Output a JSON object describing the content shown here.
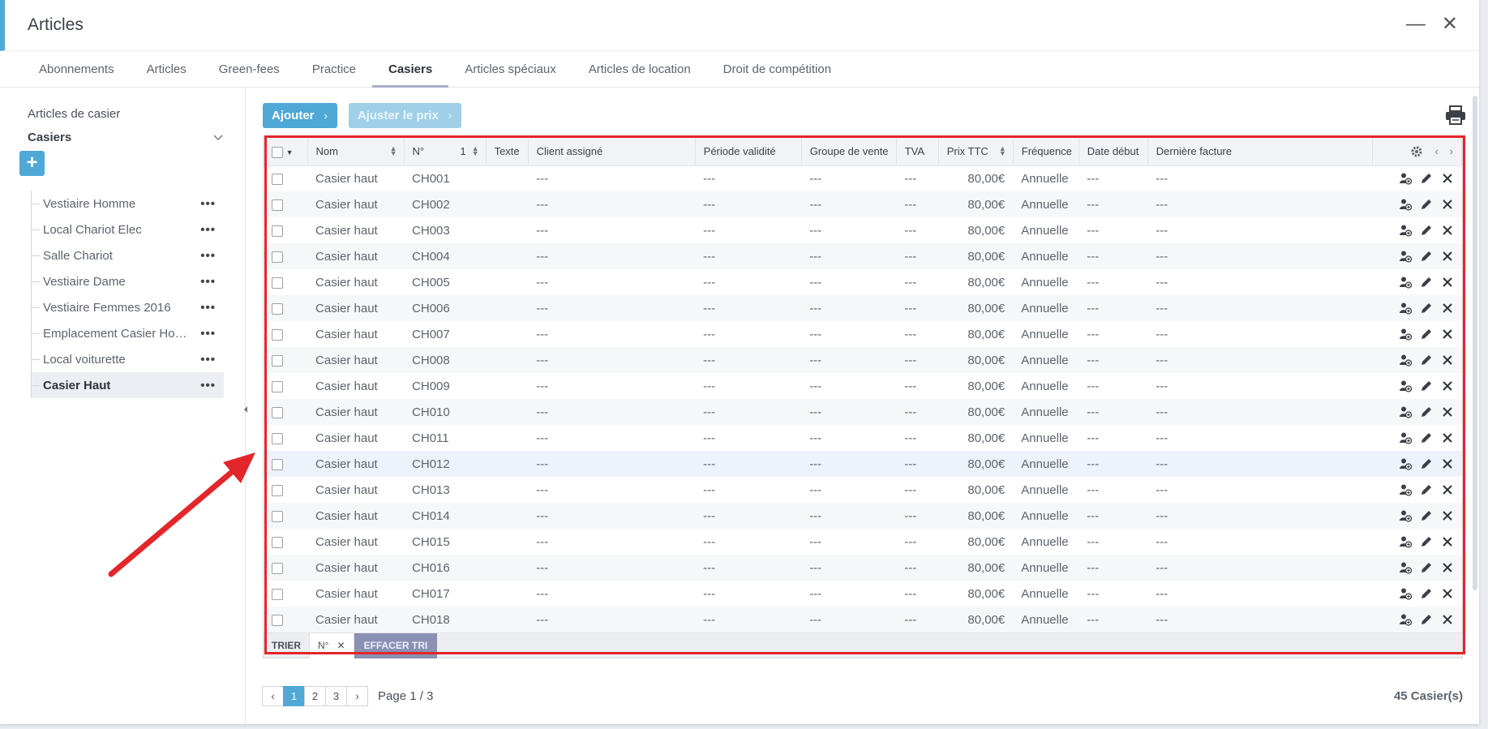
{
  "window": {
    "title": "Articles",
    "minimize": "—",
    "close": "✕"
  },
  "tabs": [
    "Abonnements",
    "Articles",
    "Green-fees",
    "Practice",
    "Casiers",
    "Articles spéciaux",
    "Articles de location",
    "Droit de compétition"
  ],
  "sidebar": {
    "title": "Articles de casier",
    "group": "Casiers",
    "add_label": "+",
    "items": [
      {
        "label": "Vestiaire Homme"
      },
      {
        "label": "Local Chariot Elec"
      },
      {
        "label": "Salle Chariot"
      },
      {
        "label": "Vestiaire Dame"
      },
      {
        "label": "Vestiaire Femmes 2016"
      },
      {
        "label": "Emplacement Casier Hom..."
      },
      {
        "label": "Local voiturette"
      },
      {
        "label": "Casier Haut"
      }
    ],
    "selected_index": 7,
    "dots": "•••"
  },
  "toolbar": {
    "add_label": "Ajouter",
    "adjust_label": "Ajuster le prix"
  },
  "table": {
    "columns": [
      "Nom",
      "N°",
      "Texte",
      "Client assigné",
      "Période validité",
      "Groupe de vente",
      "TVA",
      "Prix TTC",
      "Fréquence",
      "Date début",
      "Dernière facture"
    ],
    "sort_index": "1",
    "rows": [
      {
        "nom": "Casier haut",
        "num": "CH001",
        "texte": "",
        "client": "---",
        "periode": "---",
        "groupe": "---",
        "tva": "---",
        "prix": "80,00€",
        "freq": "Annuelle",
        "debut": "---",
        "facture": "---"
      },
      {
        "nom": "Casier haut",
        "num": "CH002",
        "texte": "",
        "client": "---",
        "periode": "---",
        "groupe": "---",
        "tva": "---",
        "prix": "80,00€",
        "freq": "Annuelle",
        "debut": "---",
        "facture": "---"
      },
      {
        "nom": "Casier haut",
        "num": "CH003",
        "texte": "",
        "client": "---",
        "periode": "---",
        "groupe": "---",
        "tva": "---",
        "prix": "80,00€",
        "freq": "Annuelle",
        "debut": "---",
        "facture": "---"
      },
      {
        "nom": "Casier haut",
        "num": "CH004",
        "texte": "",
        "client": "---",
        "periode": "---",
        "groupe": "---",
        "tva": "---",
        "prix": "80,00€",
        "freq": "Annuelle",
        "debut": "---",
        "facture": "---"
      },
      {
        "nom": "Casier haut",
        "num": "CH005",
        "texte": "",
        "client": "---",
        "periode": "---",
        "groupe": "---",
        "tva": "---",
        "prix": "80,00€",
        "freq": "Annuelle",
        "debut": "---",
        "facture": "---"
      },
      {
        "nom": "Casier haut",
        "num": "CH006",
        "texte": "",
        "client": "---",
        "periode": "---",
        "groupe": "---",
        "tva": "---",
        "prix": "80,00€",
        "freq": "Annuelle",
        "debut": "---",
        "facture": "---"
      },
      {
        "nom": "Casier haut",
        "num": "CH007",
        "texte": "",
        "client": "---",
        "periode": "---",
        "groupe": "---",
        "tva": "---",
        "prix": "80,00€",
        "freq": "Annuelle",
        "debut": "---",
        "facture": "---"
      },
      {
        "nom": "Casier haut",
        "num": "CH008",
        "texte": "",
        "client": "---",
        "periode": "---",
        "groupe": "---",
        "tva": "---",
        "prix": "80,00€",
        "freq": "Annuelle",
        "debut": "---",
        "facture": "---"
      },
      {
        "nom": "Casier haut",
        "num": "CH009",
        "texte": "",
        "client": "---",
        "periode": "---",
        "groupe": "---",
        "tva": "---",
        "prix": "80,00€",
        "freq": "Annuelle",
        "debut": "---",
        "facture": "---"
      },
      {
        "nom": "Casier haut",
        "num": "CH010",
        "texte": "",
        "client": "---",
        "periode": "---",
        "groupe": "---",
        "tva": "---",
        "prix": "80,00€",
        "freq": "Annuelle",
        "debut": "---",
        "facture": "---"
      },
      {
        "nom": "Casier haut",
        "num": "CH011",
        "texte": "",
        "client": "---",
        "periode": "---",
        "groupe": "---",
        "tva": "---",
        "prix": "80,00€",
        "freq": "Annuelle",
        "debut": "---",
        "facture": "---"
      },
      {
        "nom": "Casier haut",
        "num": "CH012",
        "texte": "",
        "client": "---",
        "periode": "---",
        "groupe": "---",
        "tva": "---",
        "prix": "80,00€",
        "freq": "Annuelle",
        "debut": "---",
        "facture": "---"
      },
      {
        "nom": "Casier haut",
        "num": "CH013",
        "texte": "",
        "client": "---",
        "periode": "---",
        "groupe": "---",
        "tva": "---",
        "prix": "80,00€",
        "freq": "Annuelle",
        "debut": "---",
        "facture": "---"
      },
      {
        "nom": "Casier haut",
        "num": "CH014",
        "texte": "",
        "client": "---",
        "periode": "---",
        "groupe": "---",
        "tva": "---",
        "prix": "80,00€",
        "freq": "Annuelle",
        "debut": "---",
        "facture": "---"
      },
      {
        "nom": "Casier haut",
        "num": "CH015",
        "texte": "",
        "client": "---",
        "periode": "---",
        "groupe": "---",
        "tva": "---",
        "prix": "80,00€",
        "freq": "Annuelle",
        "debut": "---",
        "facture": "---"
      },
      {
        "nom": "Casier haut",
        "num": "CH016",
        "texte": "",
        "client": "---",
        "periode": "---",
        "groupe": "---",
        "tva": "---",
        "prix": "80,00€",
        "freq": "Annuelle",
        "debut": "---",
        "facture": "---"
      },
      {
        "nom": "Casier haut",
        "num": "CH017",
        "texte": "",
        "client": "---",
        "periode": "---",
        "groupe": "---",
        "tva": "---",
        "prix": "80,00€",
        "freq": "Annuelle",
        "debut": "---",
        "facture": "---"
      },
      {
        "nom": "Casier haut",
        "num": "CH018",
        "texte": "",
        "client": "---",
        "periode": "---",
        "groupe": "---",
        "tva": "---",
        "prix": "80,00€",
        "freq": "Annuelle",
        "debut": "---",
        "facture": "---"
      }
    ],
    "hover_row": 11
  },
  "sort_bar": {
    "label": "TRIER",
    "chip": "N°",
    "clear": "EFFACER TRI"
  },
  "pagination": {
    "prev": "‹",
    "pages": [
      "1",
      "2",
      "3"
    ],
    "next": "›",
    "active": "1",
    "info": "Page 1 / 3",
    "count": "45 Casier(s)"
  },
  "colors": {
    "accent": "#4fa8d5",
    "highlight": "#e3262a",
    "tab_underline": "#a9aec8"
  },
  "icons": [
    "print-icon",
    "settings-gear-icon",
    "assign-user-icon",
    "edit-pencil-icon",
    "delete-x-icon",
    "chevron-down-icon",
    "chevron-left-icon",
    "chevron-right-icon",
    "annotation-arrow"
  ]
}
